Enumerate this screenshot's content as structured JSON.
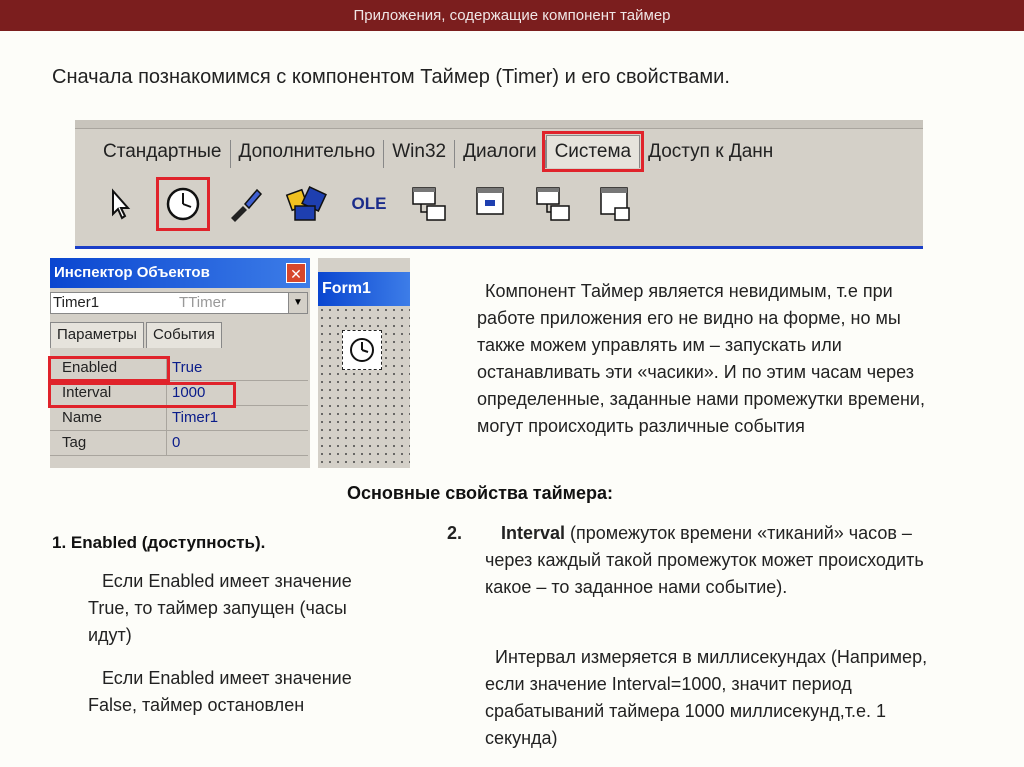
{
  "header": {
    "title": "Приложения, содержащие компонент таймер"
  },
  "intro": "Сначала познакомимся с компонентом Таймер (Timer) и его свойствами.",
  "palette": {
    "tabs": [
      "Стандартные",
      "Дополнительно",
      "Win32",
      "Диалоги",
      "Система",
      "Доступ к Данн"
    ],
    "selected_tab": "Система",
    "tools": [
      "arrow-icon",
      "timer-icon",
      "paintbox-icon",
      "mediaplayer-icon",
      "ole-icon",
      "dde-server-conv-icon",
      "dde-server-item-icon",
      "dde-client-conv-icon",
      "dde-client-item-icon"
    ],
    "ole_label": "OLE"
  },
  "inspector": {
    "title": "Инспектор Объектов",
    "combo_name": "Timer1",
    "combo_class": "TTimer",
    "tab_params": "Параметры",
    "tab_events": "События",
    "rows": [
      {
        "key": "Enabled",
        "value": "True"
      },
      {
        "key": "Interval",
        "value": "1000"
      },
      {
        "key": "Name",
        "value": "Timer1"
      },
      {
        "key": "Tag",
        "value": "0"
      }
    ]
  },
  "form": {
    "title": "Form1"
  },
  "description": "Компонент Таймер является невидимым, т.е при работе приложения его не видно на форме, но мы также можем управлять им – запускать или останавливать эти «часики». И по этим часам через определенные, заданные нами промежутки времени, могут происходить различные события",
  "subheading": "Основные свойства таймера:",
  "col1": {
    "number": "1.",
    "heading": "Enabled (доступность).",
    "p1": "Если Enabled имеет значение True, то таймер запущен (часы идут)",
    "p2": "Если Enabled имеет значение False, таймер остановлен"
  },
  "col2": {
    "number": "2.",
    "bold": "Interval",
    "rest": " (промежуток времени «тиканий» часов – через каждый такой промежуток может происходить какое – то заданное нами событие).",
    "p2": "Интервал измеряется в миллисекундах (Например, если значение Interval=1000, значит период срабатываний таймера 1000 миллисекунд,т.е. 1 секунда)"
  },
  "colors": {
    "header_bg": "#7b1e1e",
    "highlight": "#e0232b",
    "titlebar": "#0a46d0"
  }
}
